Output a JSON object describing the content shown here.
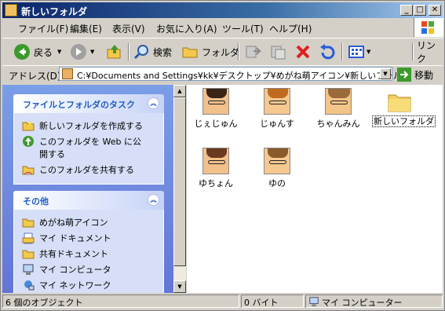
{
  "window": {
    "title": "新しいフォルダ"
  },
  "menu": [
    "ファイル(F)",
    "編集(E)",
    "表示(V)",
    "お気に入り(A)",
    "ツール(T)",
    "ヘルプ(H)"
  ],
  "toolbar": {
    "back": "戻る",
    "search": "検索",
    "folders": "フォルダ",
    "links": "リンク"
  },
  "address": {
    "label": "アドレス(D)",
    "value": "C:¥Documents and Settings¥kk¥デスクトップ¥めがね萌アイコン¥新しいフォルダ",
    "go": "移動"
  },
  "tasks_panel": {
    "title": "ファイルとフォルダのタスク",
    "items": [
      "新しいフォルダを作成する",
      "このフォルダを Web に公開する",
      "このフォルダを共有する"
    ]
  },
  "other_panel": {
    "title": "その他",
    "items": [
      "めがね萌アイコン",
      "マイ ドキュメント",
      "共有ドキュメント",
      "マイ コンピュータ",
      "マイ ネットワーク"
    ]
  },
  "files": [
    {
      "name": "じぇじゅん",
      "type": "image"
    },
    {
      "name": "じゅんす",
      "type": "image"
    },
    {
      "name": "ちゃんみん",
      "type": "image"
    },
    {
      "name": "新しいフォルダ",
      "type": "folder"
    },
    {
      "name": "ゆちょん",
      "type": "image"
    },
    {
      "name": "ゆの",
      "type": "image"
    }
  ],
  "status": {
    "objects": "6 個のオブジェクト",
    "size": "0 バイト",
    "location": "マイ コンピューター"
  },
  "colors": {
    "title_start": "#0a246a",
    "panel_title": "#215dc6",
    "pane_bg": "#6375d6"
  }
}
